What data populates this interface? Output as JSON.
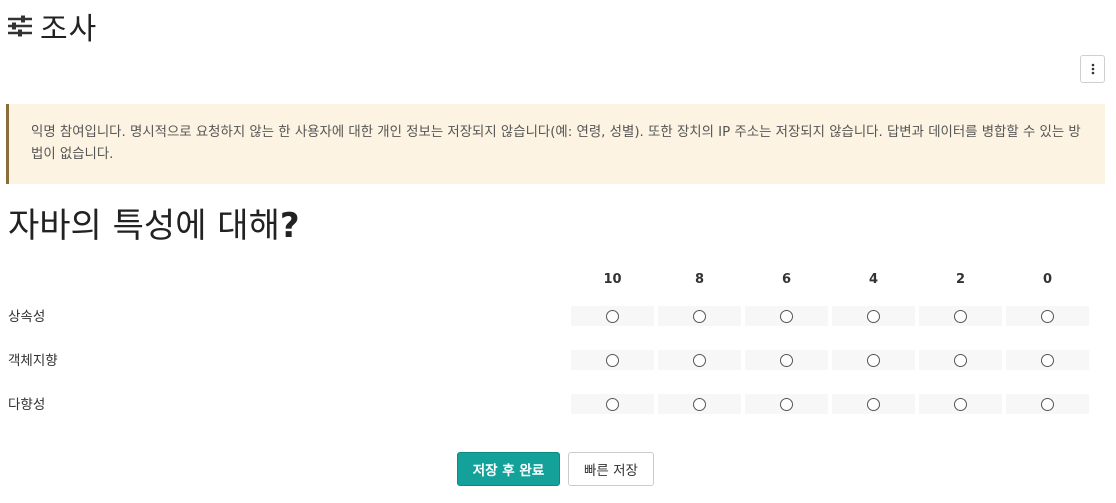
{
  "header": {
    "title": "조사",
    "icon": "sliders-icon"
  },
  "toolbar": {
    "menu_icon": "kebab-vertical-icon"
  },
  "notice": {
    "text": "익명 참여입니다. 명시적으로 요청하지 않는 한 사용자에 대한 개인 정보는 저장되지 않습니다(예: 연령, 성별). 또한 장치의 IP 주소는 저장되지 않습니다. 답변과 데이터를 병합할 수 있는 방법이 없습니다.",
    "background": "#fcf3e2",
    "border": "#8a6d3b"
  },
  "question": {
    "text": "자바의 특성에 대해",
    "mark": "?"
  },
  "scale": {
    "columns": [
      "10",
      "8",
      "6",
      "4",
      "2",
      "0"
    ],
    "rows": [
      {
        "label": "상속성"
      },
      {
        "label": "객체지향"
      },
      {
        "label": "다향성"
      }
    ]
  },
  "actions": {
    "submit_label": "저장 후 완료",
    "quick_save_label": "빠른 저장",
    "accent": "#14a19a"
  }
}
